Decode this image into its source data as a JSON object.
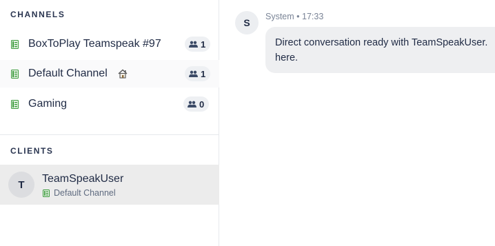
{
  "sidebar": {
    "channels_title": "CHANNELS",
    "clients_title": "CLIENTS",
    "channels": [
      {
        "label": "BoxToPlay Teamspeak #97",
        "count": "1",
        "icon": "channel-icon"
      },
      {
        "label": "Default Channel",
        "count": "1",
        "icon": "channel-icon",
        "home": "home-icon"
      },
      {
        "label": "Gaming",
        "count": "0",
        "icon": "channel-icon"
      }
    ],
    "clients": [
      {
        "initial": "T",
        "name": "TeamSpeakUser",
        "channel": "Default Channel"
      }
    ]
  },
  "chat": {
    "messages": [
      {
        "initial": "S",
        "meta": "System • 17:33",
        "text": "Direct conversation ready with TeamSpeakUser. here."
      }
    ]
  },
  "colors": {
    "channel_icon_green": "#3a9a3a",
    "selected_row": "#ececec",
    "pill_bg": "#eef0f3"
  }
}
